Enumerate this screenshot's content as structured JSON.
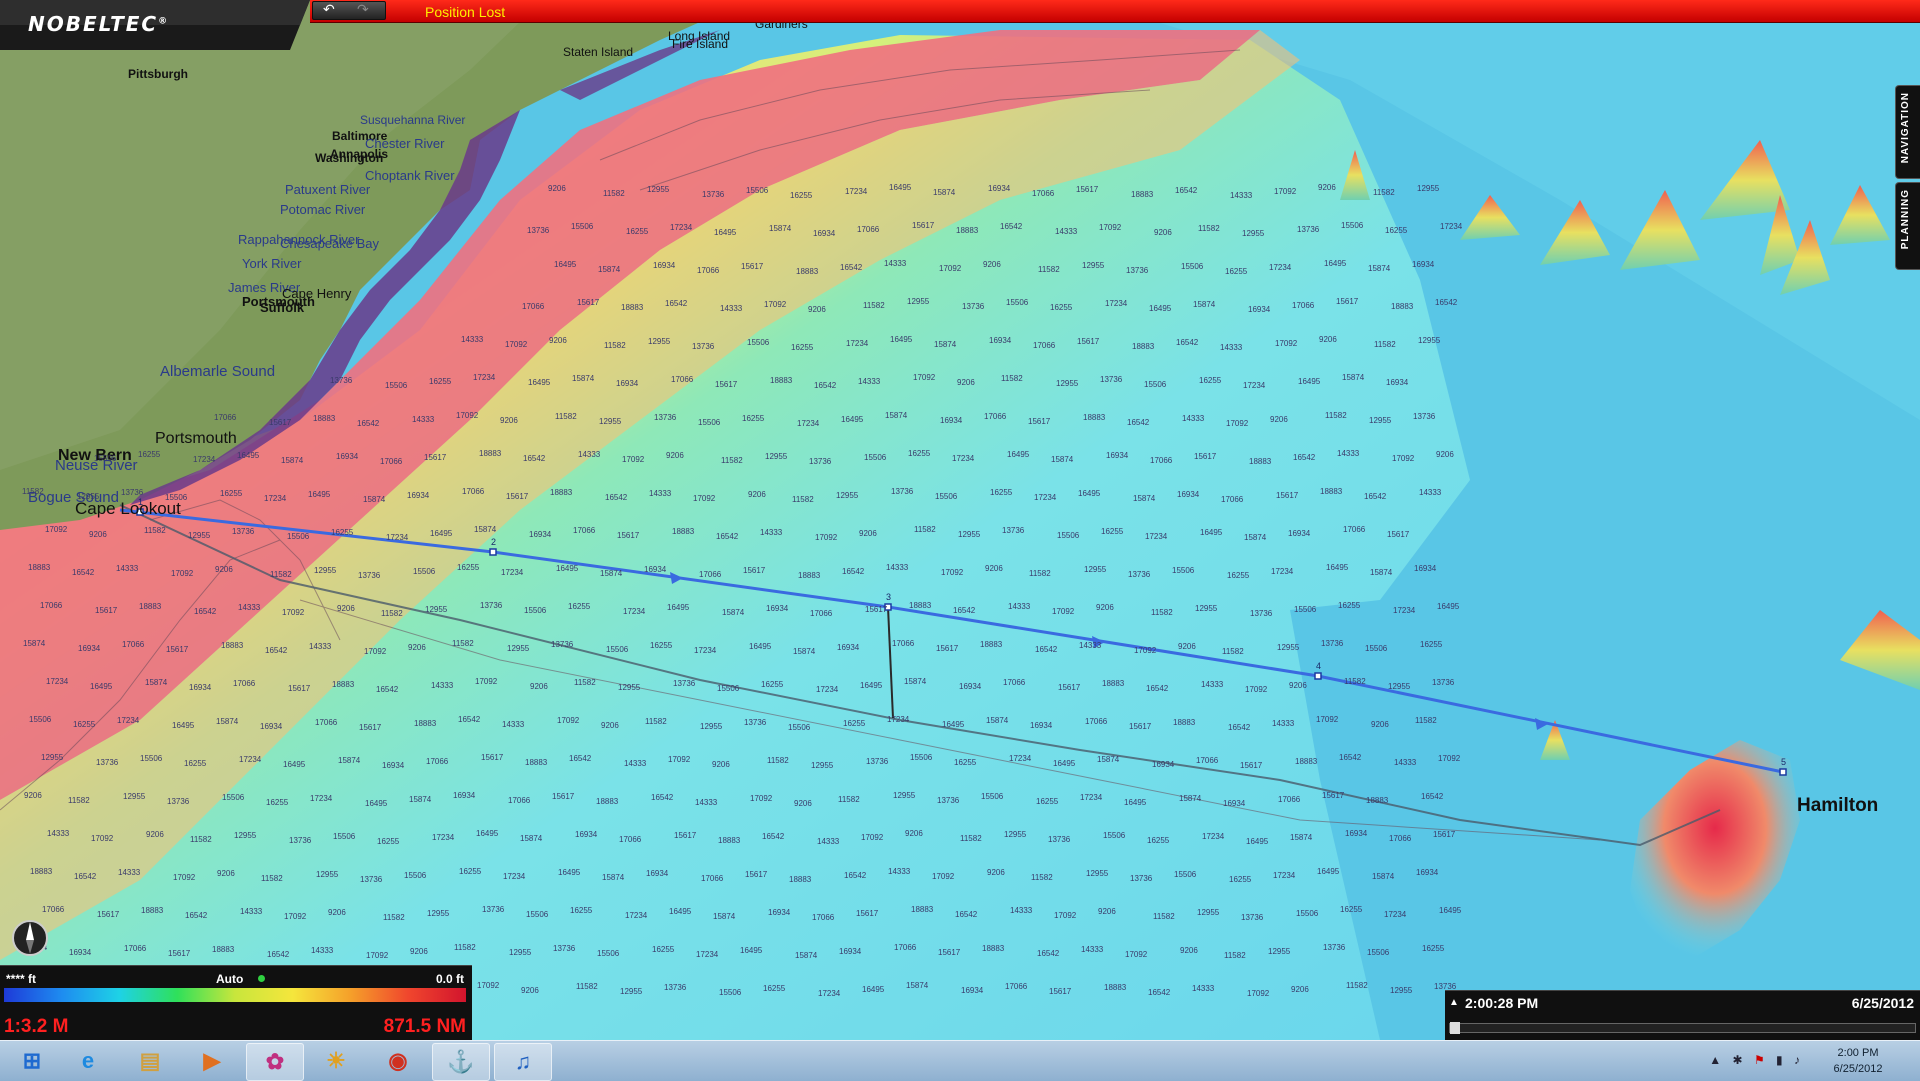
{
  "app": {
    "brand": "NOBELTEC",
    "brand_mark": "®"
  },
  "toolbar": {
    "undo_icon": "undo-icon",
    "redo_icon": "redo-icon"
  },
  "alert": {
    "text": "Position Lost",
    "color": "#ffee00"
  },
  "side_tabs": [
    {
      "label": "NAVIGATION"
    },
    {
      "label": "PLANNING"
    }
  ],
  "map": {
    "place_labels": [
      {
        "text": "Pittsburgh"
      },
      {
        "text": "Gardiners"
      },
      {
        "text": "Long Island"
      },
      {
        "text": "Fire Island"
      },
      {
        "text": "Staten Island"
      },
      {
        "text": "Susquehanna River"
      },
      {
        "text": "Baltimore"
      },
      {
        "text": "Annapolis"
      },
      {
        "text": "Washington"
      },
      {
        "text": "Chester River"
      },
      {
        "text": "Choptank River"
      },
      {
        "text": "Patuxent River"
      },
      {
        "text": "Potomac River"
      },
      {
        "text": "Rappahannock River"
      },
      {
        "text": "Chesapeake Bay"
      },
      {
        "text": "York River"
      },
      {
        "text": "James River"
      },
      {
        "text": "Cape Henry"
      },
      {
        "text": "Portsmouth"
      },
      {
        "text": "Suffolk"
      },
      {
        "text": "Albemarle Sound"
      },
      {
        "text": "Portsmouth"
      },
      {
        "text": "New Bern"
      },
      {
        "text": "Neuse River"
      },
      {
        "text": "Bogue Sound"
      },
      {
        "text": "Cape Lookout"
      },
      {
        "text": "Hamilton"
      }
    ],
    "route_waypoints": [
      "1",
      "2",
      "3",
      "4",
      "5"
    ],
    "depth_soundings": [
      "9206",
      "11582",
      "12955",
      "13736",
      "15506",
      "16255",
      "17234",
      "16495",
      "15874",
      "16934",
      "17066",
      "15617",
      "18883",
      "16542",
      "14333",
      "17092"
    ]
  },
  "depth_scale": {
    "left_label": "**** ft",
    "mode_label": "Auto",
    "right_label": "0.0 ft",
    "colors": [
      "#1e3ad8",
      "#1e8cf0",
      "#1ed2e6",
      "#2fe05a",
      "#c8e63c",
      "#f5e63c",
      "#f5a02a",
      "#f0462d",
      "#d2142d"
    ]
  },
  "status": {
    "zoom": "1:3.2 M",
    "distance": "871.5 NM"
  },
  "playback": {
    "time": "2:00:28 PM",
    "date": "6/25/2012",
    "progress": 0.0
  },
  "taskbar": {
    "apps": [
      {
        "icon": "windows-start-icon"
      },
      {
        "icon": "internet-explorer-icon"
      },
      {
        "icon": "file-explorer-icon"
      },
      {
        "icon": "media-player-icon"
      },
      {
        "icon": "picasa-icon"
      },
      {
        "icon": "photo-viewer-icon"
      },
      {
        "icon": "chrome-icon"
      },
      {
        "icon": "nobeltec-icon"
      },
      {
        "icon": "itunes-icon"
      }
    ],
    "clock_time": "2:00 PM",
    "clock_date": "6/25/2012"
  }
}
